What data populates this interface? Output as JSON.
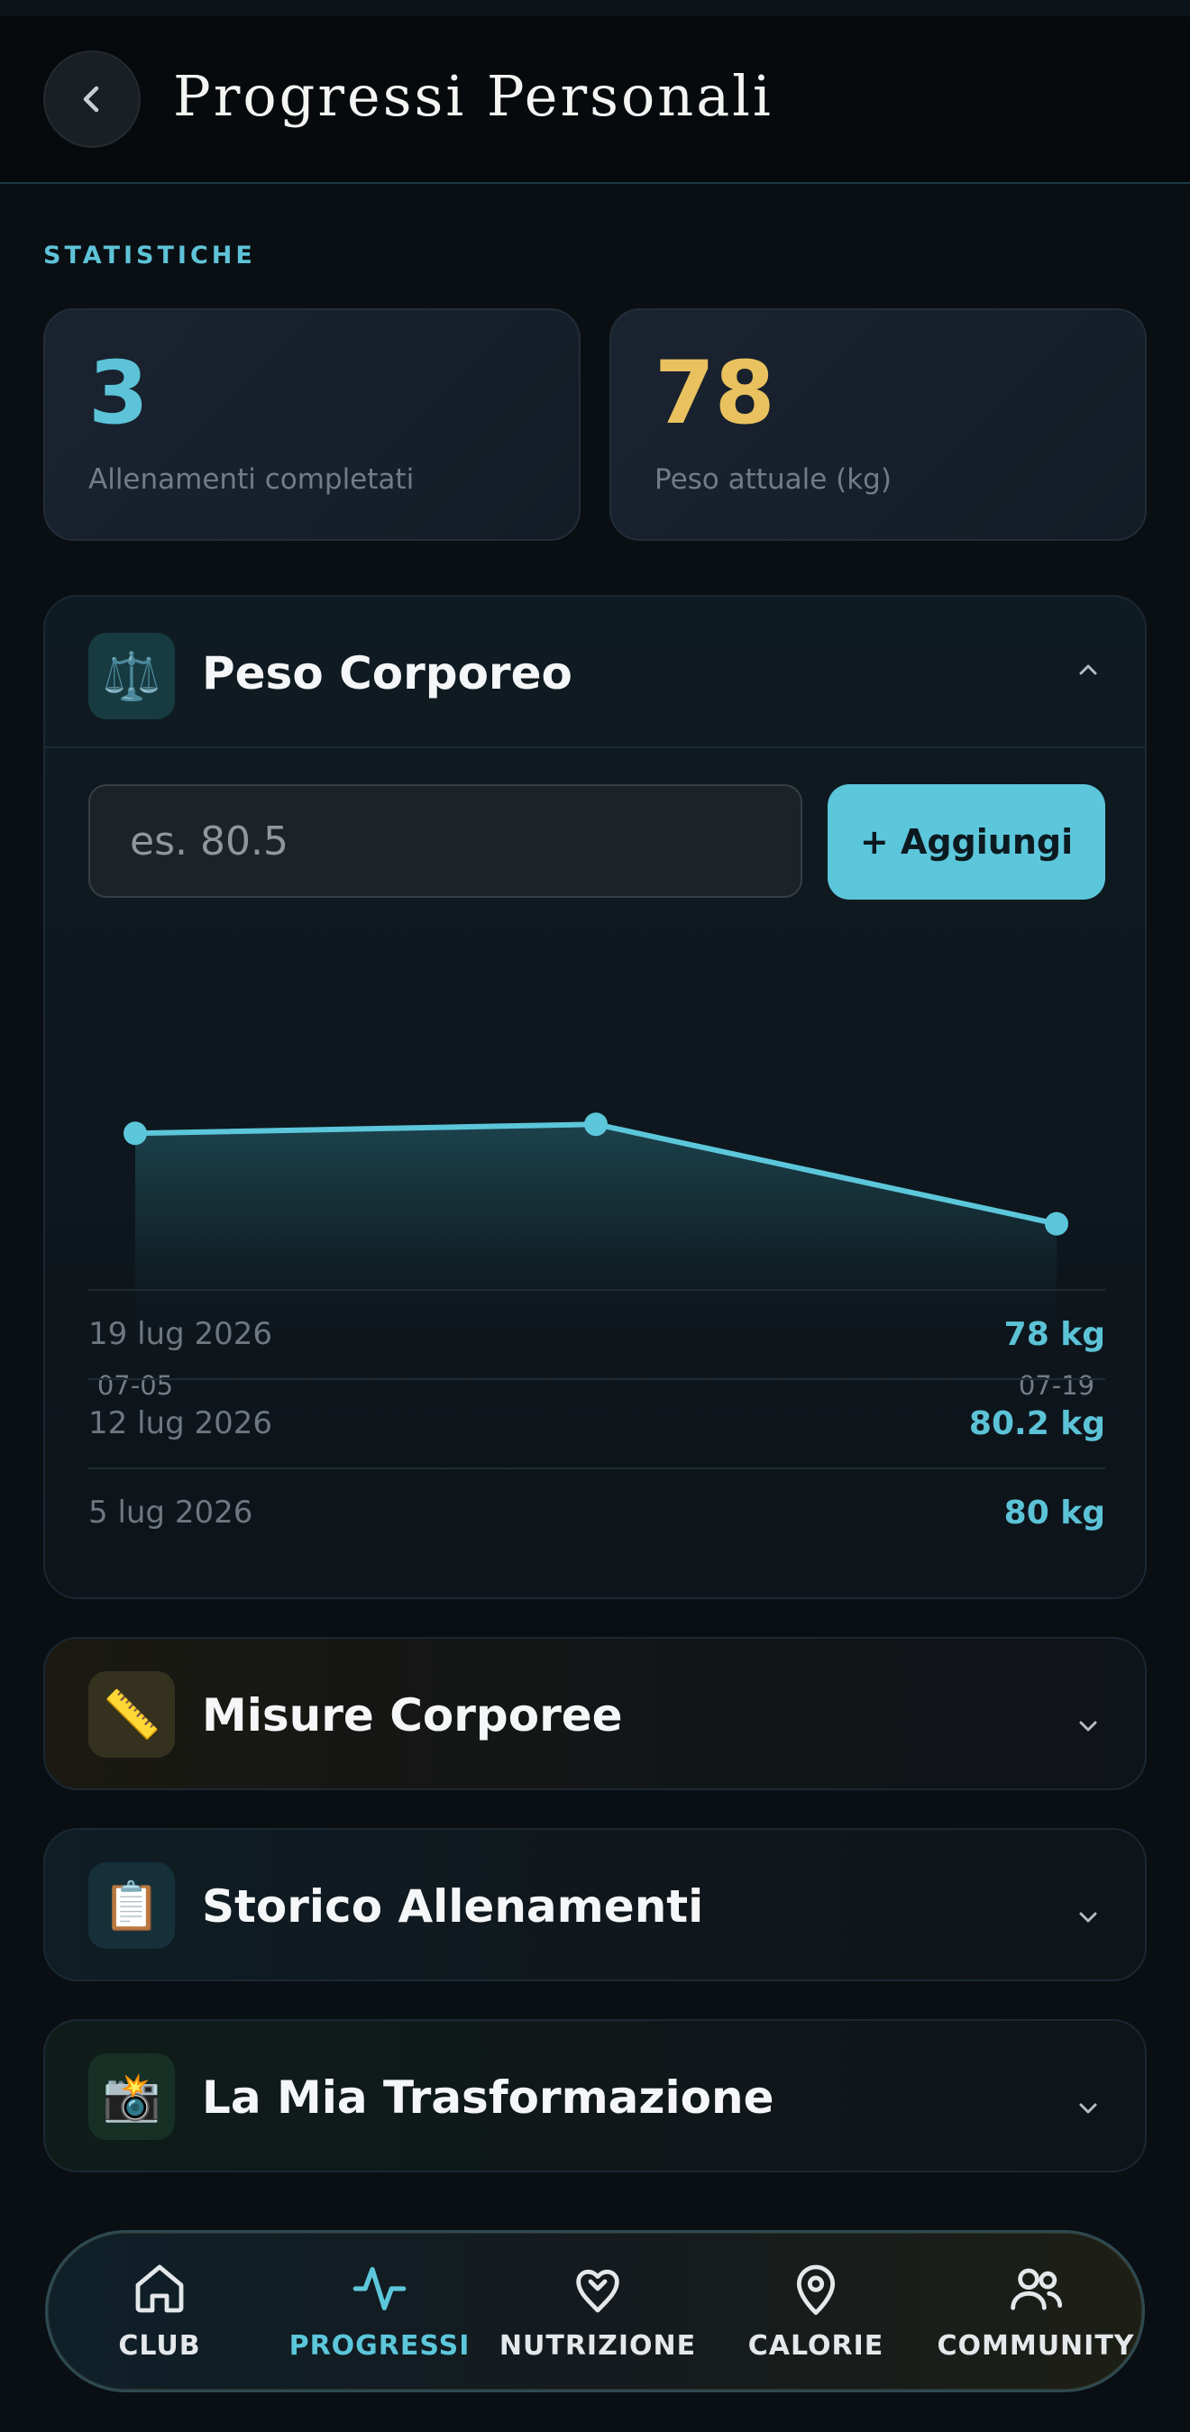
{
  "header": {
    "title": "Progressi Personali"
  },
  "stats": {
    "label": "STATISTICHE",
    "workouts": {
      "value": "3",
      "label": "Allenamenti completati"
    },
    "weight": {
      "value": "78",
      "label": "Peso attuale (kg)"
    }
  },
  "weight_panel": {
    "icon": "⚖️",
    "title": "Peso Corporeo",
    "input_placeholder": "es. 80.5",
    "add_label": "+ Aggiungi",
    "history": [
      {
        "date": "19 lug 2026",
        "value": "78 kg"
      },
      {
        "date": "12 lug 2026",
        "value": "80.2 kg"
      },
      {
        "date": "5 lug 2026",
        "value": "80 kg"
      }
    ]
  },
  "chart_data": {
    "type": "area",
    "x": [
      "07-05",
      "07-12",
      "07-19"
    ],
    "x_tick_labels": [
      "07-05",
      "07-19"
    ],
    "values": [
      80,
      80.2,
      78
    ],
    "ylim": [
      76,
      81.5
    ],
    "grid": false,
    "colors": {
      "line": "#5cc6da"
    }
  },
  "panels": [
    {
      "icon": "📏",
      "title": "Misure Corporee"
    },
    {
      "icon": "📋",
      "title": "Storico Allenamenti"
    },
    {
      "icon": "📸",
      "title": "La Mia Trasformazione"
    }
  ],
  "nav": [
    {
      "label": "CLUB",
      "icon": "home-icon",
      "active": false
    },
    {
      "label": "PROGRESSI",
      "icon": "activity-icon",
      "active": true
    },
    {
      "label": "NUTRIZIONE",
      "icon": "nutrition-icon",
      "active": false
    },
    {
      "label": "CALORIE",
      "icon": "map-pin-icon",
      "active": false
    },
    {
      "label": "COMMUNITY",
      "icon": "users-icon",
      "active": false
    }
  ],
  "colors": {
    "accent": "#5cc6da",
    "gold": "#e9c15f",
    "background": "#0a0f14"
  }
}
